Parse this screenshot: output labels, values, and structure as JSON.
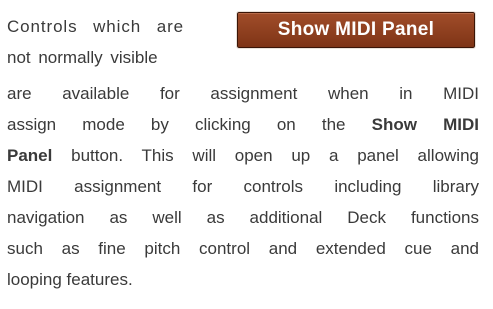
{
  "intro": {
    "line1": "Controls which are",
    "line2": "not normally visible"
  },
  "button": {
    "label": "Show MIDI Panel"
  },
  "paragraph": {
    "line3": "are available for assignment when in MIDI",
    "line4_prefix": "assign mode by clicking on the ",
    "line4_bold": "Show MIDI",
    "line5_bold": "Panel",
    "line5_suffix": " button. This will open up a panel allowing",
    "line6": "MIDI assignment for controls including library",
    "line7": "navigation as well as additional Deck functions",
    "line8": "such as fine pitch control and extended cue and",
    "line9": "looping features."
  }
}
